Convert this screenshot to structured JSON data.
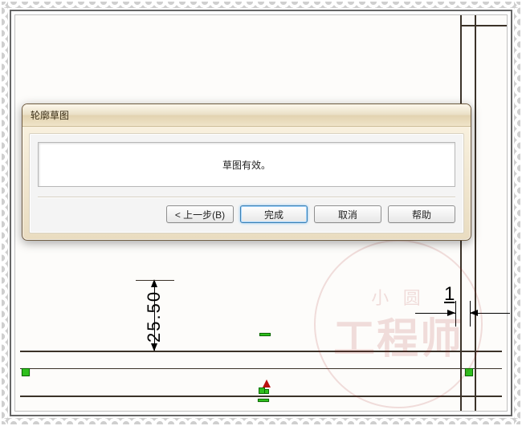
{
  "dialog": {
    "title": "轮廓草图",
    "message": "草图有效。",
    "buttons": {
      "back": "< 上一步(B)",
      "finish": "完成",
      "cancel": "取消",
      "help": "帮助"
    }
  },
  "cad": {
    "dim_vertical": "25.50",
    "dim_horizontal": "1"
  },
  "watermark": {
    "top": "小  圆",
    "main": "工程师"
  }
}
